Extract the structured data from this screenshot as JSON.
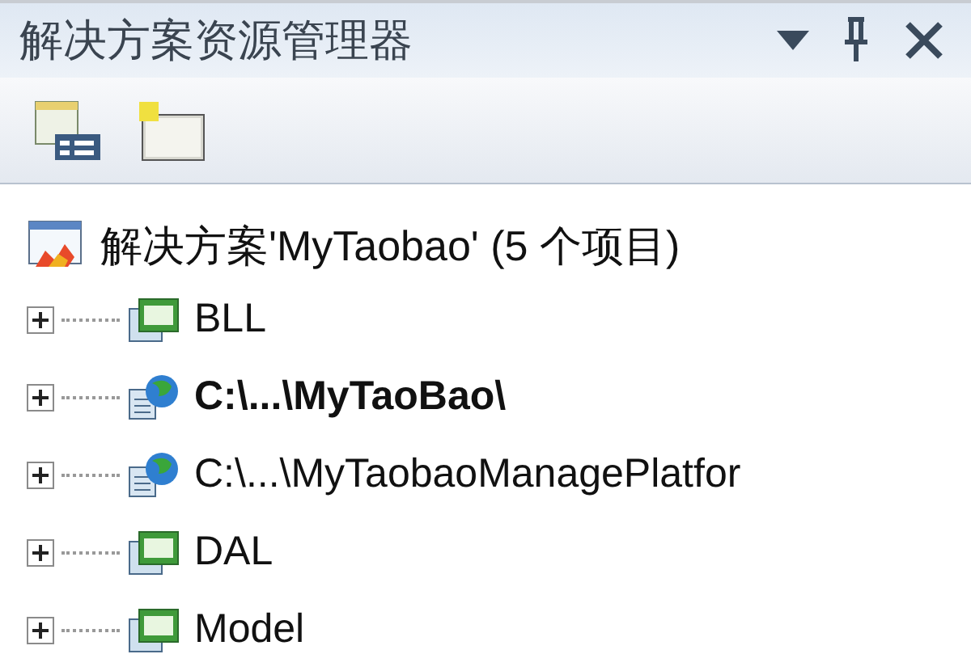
{
  "panel": {
    "title": "解决方案资源管理器"
  },
  "tree": {
    "root": {
      "label": "解决方案'MyTaobao' (5 个项目)",
      "kind": "solution"
    },
    "children": [
      {
        "label": "BLL",
        "kind": "csharp",
        "bold": false,
        "expanded": false
      },
      {
        "label": "C:\\...\\MyTaoBao\\",
        "kind": "web",
        "bold": true,
        "expanded": false
      },
      {
        "label": "C:\\...\\MyTaobaoManagePlatfor",
        "kind": "web",
        "bold": false,
        "expanded": false
      },
      {
        "label": "DAL",
        "kind": "csharp",
        "bold": false,
        "expanded": false
      },
      {
        "label": "Model",
        "kind": "csharp",
        "bold": false,
        "expanded": false
      }
    ]
  }
}
